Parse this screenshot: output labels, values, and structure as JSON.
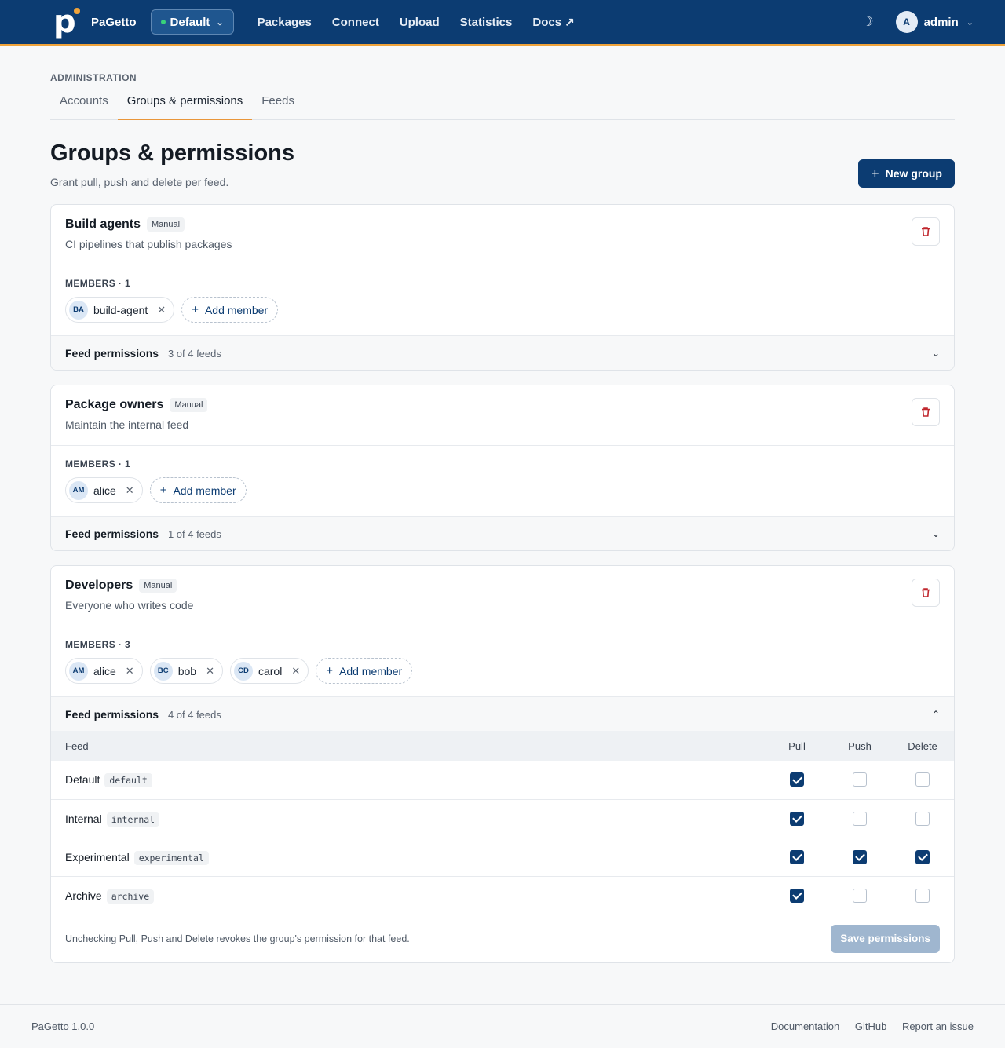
{
  "brand": {
    "name": "PaGetto",
    "logo_letter": "p"
  },
  "feed_switcher": {
    "label": "Default"
  },
  "nav": {
    "links": [
      "Packages",
      "Connect",
      "Upload",
      "Statistics",
      "Docs ↗"
    ]
  },
  "user": {
    "initial": "A",
    "name": "admin"
  },
  "section": "ADMINISTRATION",
  "tabs": [
    "Accounts",
    "Groups & permissions",
    "Feeds"
  ],
  "page": {
    "title": "Groups & permissions",
    "subtitle": "Grant pull, push and delete per feed.",
    "new_group_label": "New group"
  },
  "groups": [
    {
      "name": "Build agents",
      "badge": "Manual",
      "description": "CI pipelines that publish packages",
      "members_label": "MEMBERS · 1",
      "members": [
        {
          "initials": "BA",
          "name": "build-agent"
        }
      ],
      "add_member": "Add member",
      "perm_title": "Feed permissions",
      "perm_count": "3 of 4 feeds",
      "expanded": false
    },
    {
      "name": "Package owners",
      "badge": "Manual",
      "description": "Maintain the internal feed",
      "members_label": "MEMBERS · 1",
      "members": [
        {
          "initials": "AM",
          "name": "alice"
        }
      ],
      "add_member": "Add member",
      "perm_title": "Feed permissions",
      "perm_count": "1 of 4 feeds",
      "expanded": false
    },
    {
      "name": "Developers",
      "badge": "Manual",
      "description": "Everyone who writes code",
      "members_label": "MEMBERS · 3",
      "members": [
        {
          "initials": "AM",
          "name": "alice"
        },
        {
          "initials": "BC",
          "name": "bob"
        },
        {
          "initials": "CD",
          "name": "carol"
        }
      ],
      "add_member": "Add member",
      "perm_title": "Feed permissions",
      "perm_count": "4 of 4 feeds",
      "expanded": true,
      "table": {
        "headers": [
          "Feed",
          "Pull",
          "Push",
          "Delete"
        ],
        "rows": [
          {
            "name": "Default",
            "slug": "default",
            "pull": true,
            "push": false,
            "delete": false
          },
          {
            "name": "Internal",
            "slug": "internal",
            "pull": true,
            "push": false,
            "delete": false
          },
          {
            "name": "Experimental",
            "slug": "experimental",
            "pull": true,
            "push": true,
            "delete": true
          },
          {
            "name": "Archive",
            "slug": "archive",
            "pull": true,
            "push": false,
            "delete": false
          }
        ]
      },
      "hint": "Unchecking Pull, Push and Delete revokes the group's permission for that feed.",
      "save_label": "Save permissions"
    }
  ],
  "footer": {
    "version": "PaGetto 1.0.0",
    "links": [
      "Documentation",
      "GitHub",
      "Report an issue"
    ]
  },
  "colors": {
    "primary": "#0c3c72",
    "accent": "#f0a33a",
    "danger": "#c0262d"
  }
}
